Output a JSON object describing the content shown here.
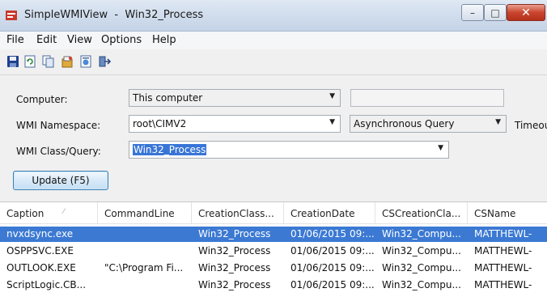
{
  "window": {
    "app_name": "SimpleWMIView",
    "separator": "-",
    "class_name": "Win32_Process",
    "minimize_glyph": "▭",
    "maximize_glyph": "□",
    "close_glyph": "✕"
  },
  "menu": [
    "File",
    "Edit",
    "View",
    "Options",
    "Help"
  ],
  "toolbar": {
    "icons": [
      "save-icon",
      "refresh-icon",
      "copy-icon",
      "properties-icon",
      "html-report-icon",
      "exit-icon"
    ]
  },
  "form": {
    "computer_label": "Computer:",
    "computer_value": "This computer",
    "namespace_label": "WMI Namespace:",
    "namespace_value": "root\\CIMV2",
    "query_mode_value": "Asynchronous Query",
    "timeout_label": "Timeout",
    "class_label": "WMI Class/Query:",
    "class_value": "Win32_Process",
    "update_button": "Update (F5)"
  },
  "columns": [
    "Caption",
    "CommandLine",
    "CreationClass...",
    "CreationDate",
    "CSCreationCla...",
    "CSName"
  ],
  "rows": [
    {
      "caption": "nvxdsync.exe",
      "commandline": "",
      "creationclass": "Win32_Process",
      "creationdate": "01/06/2015 09:...",
      "cscreationclass": "Win32_Compu...",
      "csname": "MATTHEWL-",
      "selected": true
    },
    {
      "caption": "OSPPSVC.EXE",
      "commandline": "",
      "creationclass": "Win32_Process",
      "creationdate": "01/06/2015 09:...",
      "cscreationclass": "Win32_Compu...",
      "csname": "MATTHEWL-",
      "selected": false
    },
    {
      "caption": "OUTLOOK.EXE",
      "commandline": "\"C:\\Program Fi...",
      "creationclass": "Win32_Process",
      "creationdate": "01/06/2015 09:...",
      "cscreationclass": "Win32_Compu...",
      "csname": "MATTHEWL-",
      "selected": false
    },
    {
      "caption": "ScriptLogic.CB...",
      "commandline": "",
      "creationclass": "Win32_Process",
      "creationdate": "01/06/2015 09:...",
      "cscreationclass": "Win32_Compu...",
      "csname": "MATTHEWL-",
      "selected": false
    }
  ]
}
